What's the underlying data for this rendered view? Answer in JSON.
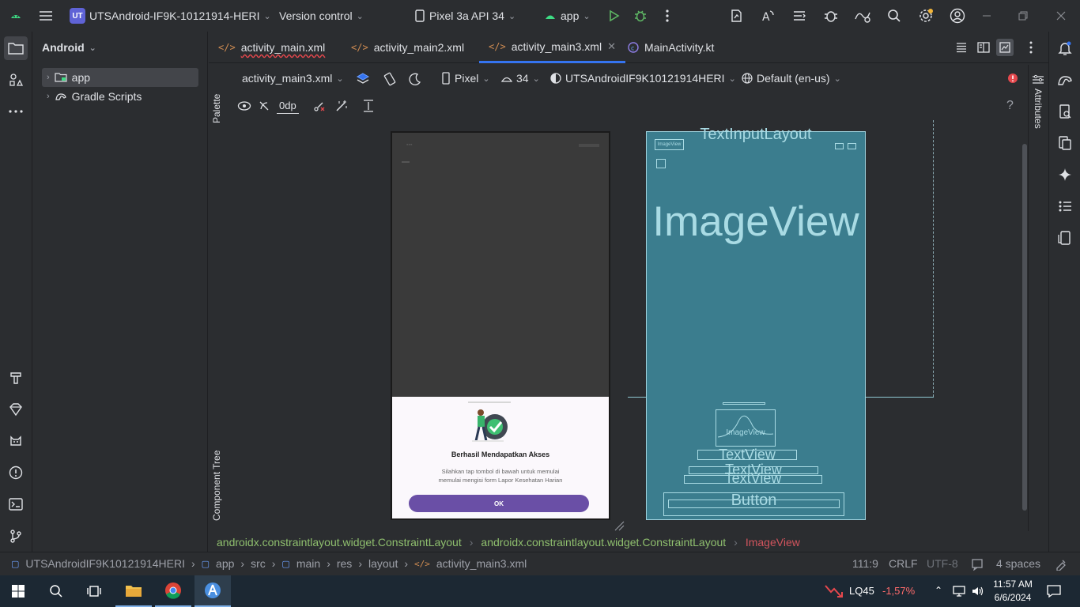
{
  "titlebar": {
    "project_badge": "UT",
    "project_name": "UTSAndroid-IF9K-10121914-HERI",
    "vcs": "Version control",
    "device": "Pixel 3a API 34",
    "run_config": "app"
  },
  "project_panel": {
    "title": "Android",
    "items": [
      {
        "label": "app",
        "icon": "folder-module-icon"
      },
      {
        "label": "Gradle Scripts",
        "icon": "gradle-icon"
      }
    ]
  },
  "tabs": [
    {
      "label": "activity_main.xml",
      "active": false,
      "error": true
    },
    {
      "label": "activity_main2.xml",
      "active": false
    },
    {
      "label": "activity_main3.xml",
      "active": true
    },
    {
      "label": "MainActivity.kt",
      "active": false
    }
  ],
  "design_toolbar": {
    "file": "activity_main3.xml",
    "device": "Pixel",
    "api": "34",
    "theme": "UTSAndroidIF9K10121914HERI",
    "locale": "Default (en-us)",
    "margin": "0dp"
  },
  "side_tabs": {
    "palette": "Palette",
    "component_tree": "Component Tree",
    "attributes": "Attributes"
  },
  "phone_preview": {
    "dialog_title": "Berhasil Mendapatkan Akses",
    "dialog_body_line1": "Silahkan tap tombol di bawah untuk memulai",
    "dialog_body_line2": "memulai mengisi form Lapor Kesehatan Harian",
    "button": "OK",
    "accent_color": "#6a4fa6"
  },
  "blueprint": {
    "top_label": "TextInputLayout",
    "small_label": "ImageView",
    "big_label": "ImageView",
    "image_label": "ImageView",
    "text1": "TextView",
    "text2": "TextView",
    "text3": "TextView",
    "button": "Button"
  },
  "breadcrumb": [
    "androidx.constraintlayout.widget.ConstraintLayout",
    "androidx.constraintlayout.widget.ConstraintLayout",
    "ImageView"
  ],
  "statusbar": {
    "path": [
      "UTSAndroidIF9K10121914HERI",
      "app",
      "src",
      "main",
      "res",
      "layout",
      "activity_main3.xml"
    ],
    "position": "111:9",
    "line_sep": "CRLF",
    "encoding": "UTF-8",
    "indent": "4 spaces"
  },
  "taskbar": {
    "stock_name": "LQ45",
    "stock_change": "-1,57%",
    "time": "11:57 AM",
    "date": "6/6/2024"
  }
}
